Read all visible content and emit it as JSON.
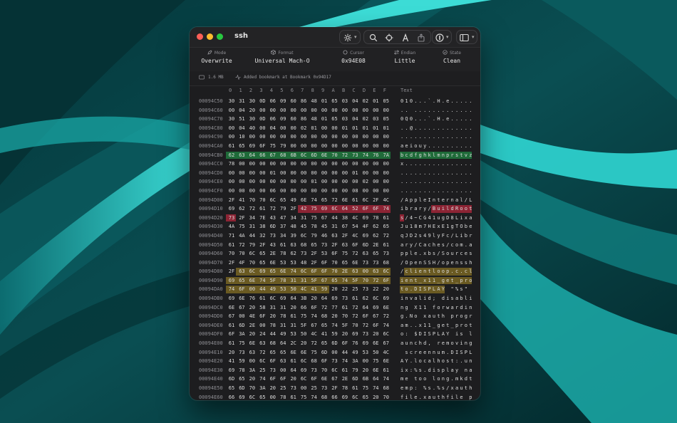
{
  "window": {
    "title": "ssh",
    "traffic_lights": {
      "close": "#ff5f57",
      "minimize": "#febc2e",
      "zoom": "#28c840"
    }
  },
  "toolbar": {
    "icons": [
      "magic-wand-icon",
      "search-icon",
      "crosshair-icon",
      "a-letter-icon",
      "share-icon",
      "info-icon",
      "sidebar-icon"
    ]
  },
  "stats": [
    {
      "label": "Mode",
      "value": "Overwrite",
      "icon": "pencil-icon"
    },
    {
      "label": "Format",
      "value": "Universal Mach-O",
      "icon": "cube-icon"
    },
    {
      "label": "Cursor",
      "value": "0x94E08",
      "icon": "target-icon"
    },
    {
      "label": "Endian",
      "value": "Little",
      "icon": "arrows-icon"
    },
    {
      "label": "State",
      "value": "Clean",
      "icon": "check-circle-icon"
    }
  ],
  "info": {
    "size": "1.6 MB",
    "message": "Added bookmark at Bookmark 0x94D17"
  },
  "columns": [
    "0",
    "1",
    "2",
    "3",
    "4",
    "5",
    "6",
    "7",
    "8",
    "9",
    "A",
    "B",
    "C",
    "D",
    "E",
    "F"
  ],
  "text_header": "Text",
  "highlight_colors": {
    "green": "#1f6b39",
    "red": "#8c2434",
    "yellow": "#6a5a22"
  },
  "rows": [
    {
      "addr": "00094C50",
      "bytes": [
        "30",
        "31",
        "30",
        "0D",
        "06",
        "09",
        "60",
        "86",
        "48",
        "01",
        "65",
        "03",
        "04",
        "02",
        "01",
        "05"
      ],
      "text": "010...`.H.e....."
    },
    {
      "addr": "00094C60",
      "bytes": [
        "00",
        "04",
        "20",
        "00",
        "00",
        "00",
        "00",
        "00",
        "00",
        "00",
        "00",
        "00",
        "00",
        "00",
        "00",
        "00"
      ],
      "text": ".. ............."
    },
    {
      "addr": "00094C70",
      "bytes": [
        "30",
        "51",
        "30",
        "0D",
        "06",
        "09",
        "60",
        "86",
        "48",
        "01",
        "65",
        "03",
        "04",
        "02",
        "03",
        "05"
      ],
      "text": "0Q0...`.H.e....."
    },
    {
      "addr": "00094C80",
      "bytes": [
        "00",
        "04",
        "40",
        "00",
        "04",
        "00",
        "00",
        "02",
        "01",
        "00",
        "00",
        "01",
        "01",
        "01",
        "01",
        "01"
      ],
      "text": "..@............."
    },
    {
      "addr": "00094C90",
      "bytes": [
        "00",
        "10",
        "00",
        "00",
        "00",
        "00",
        "00",
        "00",
        "00",
        "00",
        "00",
        "00",
        "00",
        "00",
        "00",
        "00"
      ],
      "text": "................"
    },
    {
      "addr": "00094CA0",
      "bytes": [
        "61",
        "65",
        "69",
        "6F",
        "75",
        "79",
        "00",
        "00",
        "00",
        "00",
        "00",
        "00",
        "00",
        "00",
        "00",
        "00"
      ],
      "text": "aeiouy.........."
    },
    {
      "addr": "00094CB0",
      "bytes": [
        "62",
        "63",
        "64",
        "66",
        "67",
        "68",
        "6B",
        "6C",
        "6D",
        "6E",
        "70",
        "72",
        "73",
        "74",
        "76",
        "7A"
      ],
      "text": "bcdfghklmnprstvz"
    },
    {
      "addr": "00094CC0",
      "bytes": [
        "78",
        "00",
        "00",
        "00",
        "00",
        "00",
        "00",
        "00",
        "00",
        "00",
        "00",
        "00",
        "00",
        "00",
        "00",
        "00"
      ],
      "text": "x..............."
    },
    {
      "addr": "00094CD0",
      "bytes": [
        "00",
        "00",
        "00",
        "00",
        "01",
        "00",
        "00",
        "00",
        "00",
        "00",
        "00",
        "00",
        "01",
        "00",
        "00",
        "00"
      ],
      "text": "................"
    },
    {
      "addr": "00094CE0",
      "bytes": [
        "00",
        "00",
        "00",
        "00",
        "00",
        "00",
        "00",
        "00",
        "01",
        "00",
        "00",
        "00",
        "00",
        "02",
        "00",
        "00"
      ],
      "text": "................"
    },
    {
      "addr": "00094CF0",
      "bytes": [
        "00",
        "00",
        "00",
        "00",
        "06",
        "00",
        "00",
        "00",
        "00",
        "00",
        "00",
        "00",
        "08",
        "00",
        "00",
        "00"
      ],
      "text": "................"
    },
    {
      "addr": "00094D00",
      "bytes": [
        "2F",
        "41",
        "70",
        "70",
        "6C",
        "65",
        "49",
        "6E",
        "74",
        "65",
        "72",
        "6E",
        "61",
        "6C",
        "2F",
        "4C"
      ],
      "text": "/AppleInternal/L"
    },
    {
      "addr": "00094D10",
      "bytes": [
        "69",
        "62",
        "72",
        "61",
        "72",
        "79",
        "2F",
        "42",
        "75",
        "69",
        "6C",
        "64",
        "52",
        "6F",
        "6F",
        "74"
      ],
      "text": "ibrary/BuildRoot"
    },
    {
      "addr": "00094D20",
      "bytes": [
        "73",
        "2F",
        "34",
        "7E",
        "43",
        "47",
        "34",
        "31",
        "75",
        "67",
        "44",
        "38",
        "4C",
        "69",
        "78",
        "61"
      ],
      "text": "s/4~CG41ugD8Lixa"
    },
    {
      "addr": "00094D30",
      "bytes": [
        "4A",
        "75",
        "31",
        "38",
        "6D",
        "37",
        "48",
        "45",
        "78",
        "45",
        "31",
        "67",
        "54",
        "4F",
        "62",
        "65"
      ],
      "text": "Ju18m7HExE1gTObe"
    },
    {
      "addr": "00094D40",
      "bytes": [
        "71",
        "4A",
        "44",
        "32",
        "73",
        "34",
        "39",
        "6C",
        "79",
        "46",
        "63",
        "2F",
        "4C",
        "69",
        "62",
        "72"
      ],
      "text": "qJD2s49lyFc/Libr"
    },
    {
      "addr": "00094D50",
      "bytes": [
        "61",
        "72",
        "79",
        "2F",
        "43",
        "61",
        "63",
        "68",
        "65",
        "73",
        "2F",
        "63",
        "6F",
        "6D",
        "2E",
        "61"
      ],
      "text": "ary/Caches/com.a"
    },
    {
      "addr": "00094D60",
      "bytes": [
        "70",
        "70",
        "6C",
        "65",
        "2E",
        "78",
        "62",
        "73",
        "2F",
        "53",
        "6F",
        "75",
        "72",
        "63",
        "65",
        "73"
      ],
      "text": "pple.xbs/Sources"
    },
    {
      "addr": "00094D70",
      "bytes": [
        "2F",
        "4F",
        "70",
        "65",
        "6E",
        "53",
        "53",
        "48",
        "2F",
        "6F",
        "70",
        "65",
        "6E",
        "73",
        "73",
        "68"
      ],
      "text": "/OpenSSH/openssh"
    },
    {
      "addr": "00094D80",
      "bytes": [
        "2F",
        "63",
        "6C",
        "69",
        "65",
        "6E",
        "74",
        "6C",
        "6F",
        "6F",
        "70",
        "2E",
        "63",
        "00",
        "63",
        "6C"
      ],
      "text": "/clientloop.c.cl"
    },
    {
      "addr": "00094D90",
      "bytes": [
        "69",
        "65",
        "6E",
        "74",
        "5F",
        "78",
        "31",
        "31",
        "5F",
        "67",
        "65",
        "74",
        "5F",
        "70",
        "72",
        "6F"
      ],
      "text": "ient_x11_get_pro"
    },
    {
      "addr": "00094DA0",
      "bytes": [
        "74",
        "6F",
        "00",
        "44",
        "49",
        "53",
        "50",
        "4C",
        "41",
        "59",
        "20",
        "22",
        "25",
        "73",
        "22",
        "20"
      ],
      "text": "to.DISPLAY \"%s\" "
    },
    {
      "addr": "00094DB0",
      "bytes": [
        "69",
        "6E",
        "76",
        "61",
        "6C",
        "69",
        "64",
        "3B",
        "20",
        "64",
        "69",
        "73",
        "61",
        "62",
        "6C",
        "69"
      ],
      "text": "invalid; disabli"
    },
    {
      "addr": "00094DC0",
      "bytes": [
        "6E",
        "67",
        "20",
        "58",
        "31",
        "31",
        "20",
        "66",
        "6F",
        "72",
        "77",
        "61",
        "72",
        "64",
        "69",
        "6E"
      ],
      "text": "ng X11 forwardin"
    },
    {
      "addr": "00094DD0",
      "bytes": [
        "67",
        "00",
        "4E",
        "6F",
        "20",
        "78",
        "61",
        "75",
        "74",
        "68",
        "20",
        "70",
        "72",
        "6F",
        "67",
        "72"
      ],
      "text": "g.No xauth progr"
    },
    {
      "addr": "00094DE0",
      "bytes": [
        "61",
        "6D",
        "2E",
        "00",
        "78",
        "31",
        "31",
        "5F",
        "67",
        "65",
        "74",
        "5F",
        "70",
        "72",
        "6F",
        "74"
      ],
      "text": "am..x11_get_prot"
    },
    {
      "addr": "00094DF0",
      "bytes": [
        "6F",
        "3A",
        "20",
        "24",
        "44",
        "49",
        "53",
        "50",
        "4C",
        "41",
        "59",
        "20",
        "69",
        "73",
        "20",
        "6C"
      ],
      "text": "o: $DISPLAY is l"
    },
    {
      "addr": "00094E00",
      "bytes": [
        "61",
        "75",
        "6E",
        "63",
        "68",
        "64",
        "2C",
        "20",
        "72",
        "65",
        "6D",
        "6F",
        "76",
        "69",
        "6E",
        "67"
      ],
      "text": "aunchd, removing"
    },
    {
      "addr": "00094E10",
      "bytes": [
        "20",
        "73",
        "63",
        "72",
        "65",
        "65",
        "6E",
        "6E",
        "75",
        "6D",
        "00",
        "44",
        "49",
        "53",
        "50",
        "4C"
      ],
      "text": " screennum.DISPL"
    },
    {
      "addr": "00094E20",
      "bytes": [
        "41",
        "59",
        "00",
        "6C",
        "6F",
        "63",
        "61",
        "6C",
        "68",
        "6F",
        "73",
        "74",
        "3A",
        "00",
        "75",
        "6E"
      ],
      "text": "AY.localhost:.un"
    },
    {
      "addr": "00094E30",
      "bytes": [
        "69",
        "78",
        "3A",
        "25",
        "73",
        "00",
        "64",
        "69",
        "73",
        "70",
        "6C",
        "61",
        "79",
        "20",
        "6E",
        "61"
      ],
      "text": "ix:%s.display na"
    },
    {
      "addr": "00094E40",
      "bytes": [
        "6D",
        "65",
        "20",
        "74",
        "6F",
        "6F",
        "20",
        "6C",
        "6F",
        "6E",
        "67",
        "2E",
        "6D",
        "6B",
        "64",
        "74"
      ],
      "text": "me too long.mkdt"
    },
    {
      "addr": "00094E50",
      "bytes": [
        "65",
        "6D",
        "70",
        "3A",
        "20",
        "25",
        "73",
        "00",
        "25",
        "73",
        "2F",
        "78",
        "61",
        "75",
        "74",
        "68"
      ],
      "text": "emp: %s.%s/xauth"
    },
    {
      "addr": "00094E60",
      "bytes": [
        "66",
        "69",
        "6C",
        "65",
        "00",
        "78",
        "61",
        "75",
        "74",
        "68",
        "66",
        "69",
        "6C",
        "65",
        "20",
        "70"
      ],
      "text": "file.xauthfile p"
    }
  ]
}
